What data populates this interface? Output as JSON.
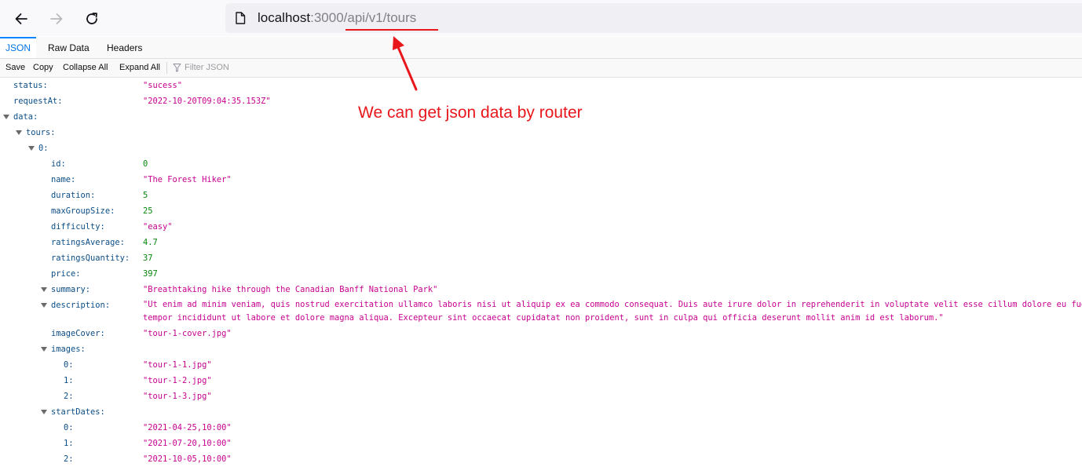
{
  "browser": {
    "url_host": "localhost",
    "url_port": ":3000",
    "url_path": "/api/v1/tours",
    "icons": {
      "back": "arrow-left-icon",
      "forward": "arrow-right-icon",
      "reload": "reload-icon",
      "site": "page-icon"
    }
  },
  "viewer_tabs": [
    {
      "label": "JSON",
      "selected": true
    },
    {
      "label": "Raw Data",
      "selected": false
    },
    {
      "label": "Headers",
      "selected": false
    }
  ],
  "viewer_toolbar": {
    "save": "Save",
    "copy": "Copy",
    "collapse_all": "Collapse All",
    "expand_all": "Expand All",
    "filter_placeholder": "Filter JSON"
  },
  "annotation": {
    "text": "We can get json data by router",
    "color": "#e8171c"
  },
  "json": {
    "status_key": "status:",
    "status_val": "\"sucess\"",
    "requestAt_key": "requestAt:",
    "requestAt_val": "\"2022-10-20T09:04:35.153Z\"",
    "data_key": "data:",
    "tours_key": "tours:",
    "item0_key": "0:",
    "id_key": "id:",
    "id_val": "0",
    "name_key": "name:",
    "name_val": "\"The Forest Hiker\"",
    "duration_key": "duration:",
    "duration_val": "5",
    "maxGroupSize_key": "maxGroupSize:",
    "maxGroupSize_val": "25",
    "difficulty_key": "difficulty:",
    "difficulty_val": "\"easy\"",
    "ratingsAverage_key": "ratingsAverage:",
    "ratingsAverage_val": "4.7",
    "ratingsQuantity_key": "ratingsQuantity:",
    "ratingsQuantity_val": "37",
    "price_key": "price:",
    "price_val": "397",
    "summary_key": "summary:",
    "summary_val": "\"Breathtaking hike through the Canadian Banff National Park\"",
    "description_key": "description:",
    "description_line1": "\"Ut enim ad minim veniam, quis nostrud exercitation ullamco laboris nisi ut aliquip ex ea commodo consequat. Duis aute irure dolor in reprehenderit in voluptate velit esse cillum dolore eu fugiat null",
    "description_line2": "tempor incididunt ut labore et dolore magna aliqua. Excepteur sint occaecat cupidatat non proident, sunt in culpa qui officia deserunt mollit anim id est laborum.\"",
    "imageCover_key": "imageCover:",
    "imageCover_val": "\"tour-1-cover.jpg\"",
    "images_key": "images:",
    "images": [
      {
        "key": "0:",
        "val": "\"tour-1-1.jpg\""
      },
      {
        "key": "1:",
        "val": "\"tour-1-2.jpg\""
      },
      {
        "key": "2:",
        "val": "\"tour-1-3.jpg\""
      }
    ],
    "startDates_key": "startDates:",
    "startDates": [
      {
        "key": "0:",
        "val": "\"2021-04-25,10:00\""
      },
      {
        "key": "1:",
        "val": "\"2021-07-20,10:00\""
      },
      {
        "key": "2:",
        "val": "\"2021-10-05,10:00\""
      }
    ]
  }
}
